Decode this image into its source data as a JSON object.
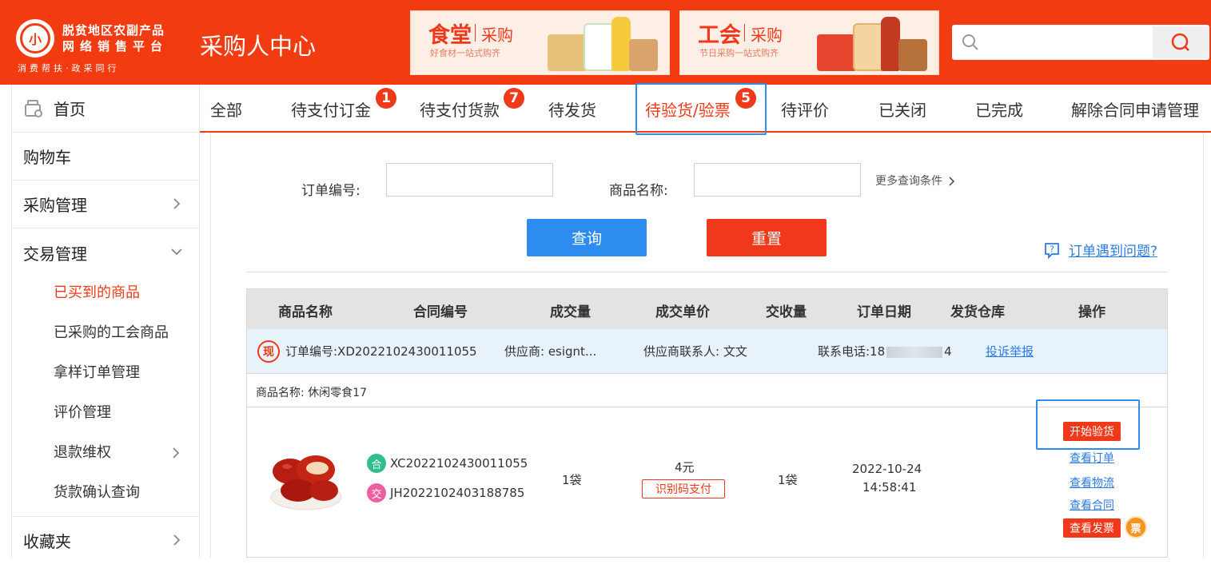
{
  "header": {
    "logo_char": "小",
    "brand_line1": "脱贫地区农副产品",
    "brand_line2": "网络销售平台",
    "slogan": "消费帮扶·政采同行",
    "center_title": "采购人中心",
    "banners": [
      {
        "title": "食堂",
        "subtitle": "采购",
        "desc": "好食材一站式购齐"
      },
      {
        "title": "工会",
        "subtitle": "采购",
        "desc": "节日采购一站式购齐"
      }
    ],
    "search": {
      "value": "",
      "placeholder": ""
    }
  },
  "sidebar": {
    "items": [
      {
        "label": "首页"
      },
      {
        "label": "购物车"
      },
      {
        "label": "采购管理"
      },
      {
        "label": "交易管理"
      },
      {
        "label": "收藏夹"
      }
    ],
    "sub_items": [
      {
        "label": "已买到的商品"
      },
      {
        "label": "已采购的工会商品"
      },
      {
        "label": "拿样订单管理"
      },
      {
        "label": "评价管理"
      },
      {
        "label": "退款维权"
      },
      {
        "label": "货款确认查询"
      }
    ]
  },
  "tabs": [
    {
      "label": "全部"
    },
    {
      "label": "待支付订金",
      "badge": "1"
    },
    {
      "label": "待支付货款",
      "badge": "7"
    },
    {
      "label": "待发货"
    },
    {
      "label": "待验货/验票",
      "badge": "5"
    },
    {
      "label": "待评价"
    },
    {
      "label": "已关闭"
    },
    {
      "label": "已完成"
    },
    {
      "label": "解除合同申请管理"
    }
  ],
  "filters": {
    "order_no_label": "订单编号:",
    "order_no_value": "",
    "product_name_label": "商品名称:",
    "product_name_value": "",
    "more_conditions": "更多查询条件",
    "query_button": "查询",
    "reset_button": "重置",
    "help_link": "订单遇到问题?"
  },
  "table": {
    "headers": [
      "商品名称",
      "合同编号",
      "成交量",
      "成交单价",
      "交收量",
      "订单日期",
      "发货仓库",
      "操作"
    ],
    "order": {
      "type_tag": "现",
      "order_no": "订单编号:XD2022102430011055",
      "supplier": "供应商:  esignt...",
      "contact": "供应商联系人:  文文",
      "phone_prefix": "联系电话:18",
      "phone_suffix": "4",
      "complain": "投诉举报"
    },
    "product_name_line": "商品名称:  休闲零食17",
    "row": {
      "contract_tag": "合",
      "contract_no": "XC2022102430011055",
      "trade_tag": "交",
      "trade_no": "JH2022102403188785",
      "volume": "1袋",
      "unit_price": "4元",
      "pay_method": "识别码支付",
      "delivery_qty": "1袋",
      "order_date": "2022-10-24",
      "order_time": "14:58:41",
      "actions": {
        "start_inspect": "开始验货",
        "view_order": "查看订单",
        "view_logistics": "查看物流",
        "view_contract": "查看合同",
        "view_invoice": "查看发票",
        "invoice_tag": "票"
      }
    }
  },
  "colors": {
    "brand_red": "#f33b12",
    "accent_blue": "#2d8cf0",
    "link_blue": "#2c7be5"
  }
}
